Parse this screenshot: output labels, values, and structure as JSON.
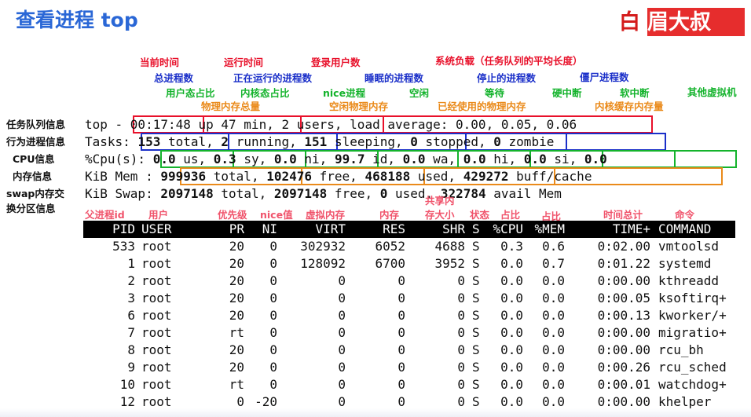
{
  "title": "查看进程 top",
  "logo": {
    "text_left": "白",
    "text_right": "眉大叔"
  },
  "annotations": {
    "current_time": "当前时间",
    "run_time": "运行时间",
    "login_users": "登录用户数",
    "load": "系统负载（任务队列的平均长度）",
    "total_procs": "总进程数",
    "running_procs": "正在运行的进程数",
    "sleeping_procs": "睡眠的进程数",
    "stopped_procs": "停止的进程数",
    "zombie_procs": "僵尸进程数",
    "us": "用户态占比",
    "sy": "内核态占比",
    "ni": "nice进程",
    "id": "空闲",
    "wa": "等待",
    "hi": "硬中断",
    "si": "软中断",
    "st": "其他虚拟机",
    "mem_total": "物理内存总量",
    "mem_free": "空闲物理内存",
    "mem_used": "已经使用的物理内存",
    "buff": "内核缓存内存量"
  },
  "row_labels": {
    "task_queue": "任务队列信息",
    "process_info": "行为进程信息",
    "cpu": "CPU信息",
    "mem": "内存信息",
    "swap1": "swap内存交",
    "swap2": "换分区信息"
  },
  "col_annotations": {
    "pid": "父进程id",
    "user": "用户",
    "pr": "优先级",
    "ni": "nice值",
    "virt": "虚拟内存",
    "res": "内存",
    "shr1": "共享内",
    "shr2": "存大小",
    "s": "状态",
    "cpu": "占比",
    "mem": "占比",
    "time": "时间总计",
    "cmd": "命令"
  },
  "top_lines": {
    "l1_prefix": "top - ",
    "l1_time": "00:17:48",
    "l1_up": "up 47 min,",
    "l1_users": "2 users,",
    "l1_load": "load average: 0.00, 0.05, 0.06",
    "l2_prefix": "Tasks:",
    "l2_total_num": "153",
    "l2_total_txt": " total,",
    "l2_run_num": "2",
    "l2_run_txt": " running,",
    "l2_sleep_num": "151",
    "l2_sleep_txt": " sleeping,",
    "l2_stop_num": "0",
    "l2_stop_txt": " stopped,",
    "l2_zombie_num": "0",
    "l2_zombie_txt": " zombie",
    "l3_prefix": "%Cpu(s):",
    "l3_us_num": "0.0",
    "l3_us_txt": " us,",
    "l3_sy_num": "0.3",
    "l3_sy_txt": " sy,",
    "l3_ni_num": "0.0",
    "l3_ni_txt": " ni,",
    "l3_id_num": "99.7",
    "l3_id_txt": " id,",
    "l3_wa_num": "0.0",
    "l3_wa_txt": " wa,",
    "l3_hi_num": "0.0",
    "l3_hi_txt": " hi,",
    "l3_si_num": "0.0",
    "l3_si_txt": " si,",
    "l3_st_num": "0.0",
    "l4_prefix": "KiB Mem :",
    "l4_total_num": "999936",
    "l4_total_txt": " total,",
    "l4_free_num": "102476",
    "l4_free_txt": " free,",
    "l4_used_num": "468188",
    "l4_used_txt": " used,",
    "l4_buff_num": "429272",
    "l4_buff_txt": " buff/cache",
    "l5_prefix": "KiB Swap:",
    "l5_total_num": "2097148",
    "l5_total_txt": " total,",
    "l5_free_num": "2097148",
    "l5_free_txt": " free,",
    "l5_used_num": "0",
    "l5_used_txt": " used.",
    "l5_avail_num": "322784",
    "l5_avail_txt": " avail Mem"
  },
  "table": {
    "headers": [
      "PID",
      "USER",
      "PR",
      "NI",
      "VIRT",
      "RES",
      "SHR",
      "S",
      "%CPU",
      "%MEM",
      "TIME+",
      "COMMAND"
    ],
    "rows": [
      [
        "533",
        "root",
        "20",
        "0",
        "302932",
        "6052",
        "4688",
        "S",
        "0.3",
        "0.6",
        "0:02.00",
        "vmtoolsd"
      ],
      [
        "1",
        "root",
        "20",
        "0",
        "128092",
        "6700",
        "3952",
        "S",
        "0.0",
        "0.7",
        "0:01.22",
        "systemd"
      ],
      [
        "2",
        "root",
        "20",
        "0",
        "0",
        "0",
        "0",
        "S",
        "0.0",
        "0.0",
        "0:00.00",
        "kthreadd"
      ],
      [
        "3",
        "root",
        "20",
        "0",
        "0",
        "0",
        "0",
        "S",
        "0.0",
        "0.0",
        "0:00.05",
        "ksoftirq+"
      ],
      [
        "6",
        "root",
        "20",
        "0",
        "0",
        "0",
        "0",
        "S",
        "0.0",
        "0.0",
        "0:00.13",
        "kworker/+"
      ],
      [
        "7",
        "root",
        "rt",
        "0",
        "0",
        "0",
        "0",
        "S",
        "0.0",
        "0.0",
        "0:00.00",
        "migratio+"
      ],
      [
        "8",
        "root",
        "20",
        "0",
        "0",
        "0",
        "0",
        "S",
        "0.0",
        "0.0",
        "0:00.00",
        "rcu_bh"
      ],
      [
        "9",
        "root",
        "20",
        "0",
        "0",
        "0",
        "0",
        "S",
        "0.0",
        "0.0",
        "0:00.26",
        "rcu_sched"
      ],
      [
        "10",
        "root",
        "rt",
        "0",
        "0",
        "0",
        "0",
        "S",
        "0.0",
        "0.0",
        "0:00.01",
        "watchdog+"
      ],
      [
        "12",
        "root",
        "0",
        "-20",
        "0",
        "0",
        "0",
        "S",
        "0.0",
        "0.0",
        "0:00.00",
        "khelper"
      ]
    ]
  },
  "colors": {
    "title": "#2a67d6",
    "red": "#e8102a",
    "blue": "#1a2fc9",
    "green": "#14b32c",
    "orange": "#ea8a1a"
  }
}
